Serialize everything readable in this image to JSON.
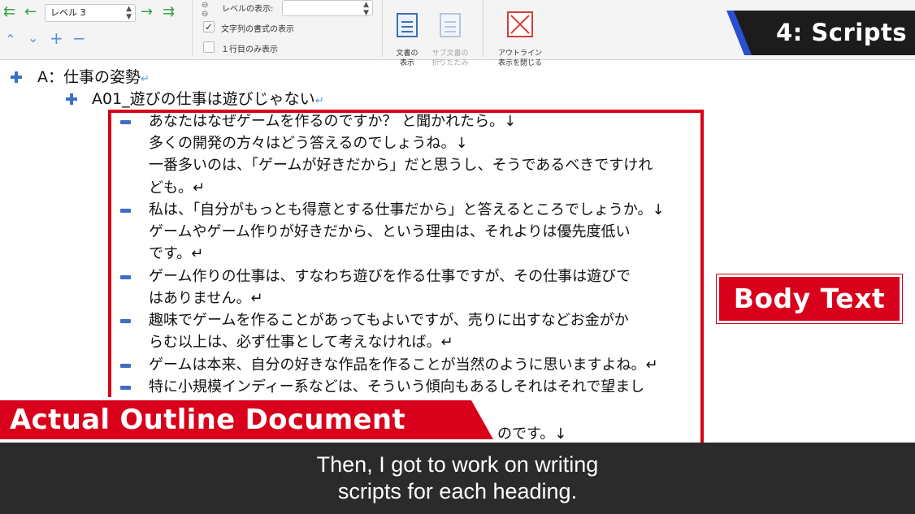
{
  "toolbar": {
    "level_select_value": "レベル 3",
    "level_display_label": "レベルの表示:",
    "level_display_value": "",
    "checkbox_text_format_label": "文字列の書式の表示",
    "checkbox_text_format_checked": true,
    "checkbox_first_line_label": "１行目のみ表示",
    "checkbox_first_line_checked": false,
    "show_document_label": "文書の\n表示",
    "collapse_subdocuments_label": "サブ文書の\n折りたたみ",
    "close_outline_label": "アウトライン\n表示を閉じる"
  },
  "badge": {
    "scripts": "4: Scripts"
  },
  "outline": {
    "level1": "A：仕事の姿勢",
    "level2": "A01_遊びの仕事は遊びじゃない",
    "paragraphs": [
      {
        "text": "あなたはなぜゲームを作るのですか？ と聞かれたら。↓\n多くの開発の方々はどう答えるのでしょうね。↓\n一番多いのは、「ゲームが好きだから」だと思うし、そうであるべきですけれ\nども。↵"
      },
      {
        "text": "私は、「自分がもっとも得意とする仕事だから」と答えるところでしょうか。↓\nゲームやゲーム作りが好きだから、という理由は、それよりは優先度低い\nです。↵"
      },
      {
        "text": "ゲーム作りの仕事は、すなわち遊びを作る仕事ですが、その仕事は遊びで\nはありません。↵"
      },
      {
        "text": "趣味でゲームを作ることがあってもよいですが、売りに出すなどお金がか\nらむ以上は、必ず仕事として考えなければ。↵"
      },
      {
        "text": "ゲームは本来、自分の好きな作品を作ることが当然のように思いますよね。↵"
      },
      {
        "text": "特に小規模インディー系などは、そういう傾向もあるしそれはそれで望まし"
      }
    ],
    "partial_line": "のです。↓"
  },
  "labels": {
    "body_text": "Body Text",
    "actual_outline": "Actual Outline Document"
  },
  "caption": {
    "text": "Then, I got to work on writing\nscripts for each heading."
  }
}
